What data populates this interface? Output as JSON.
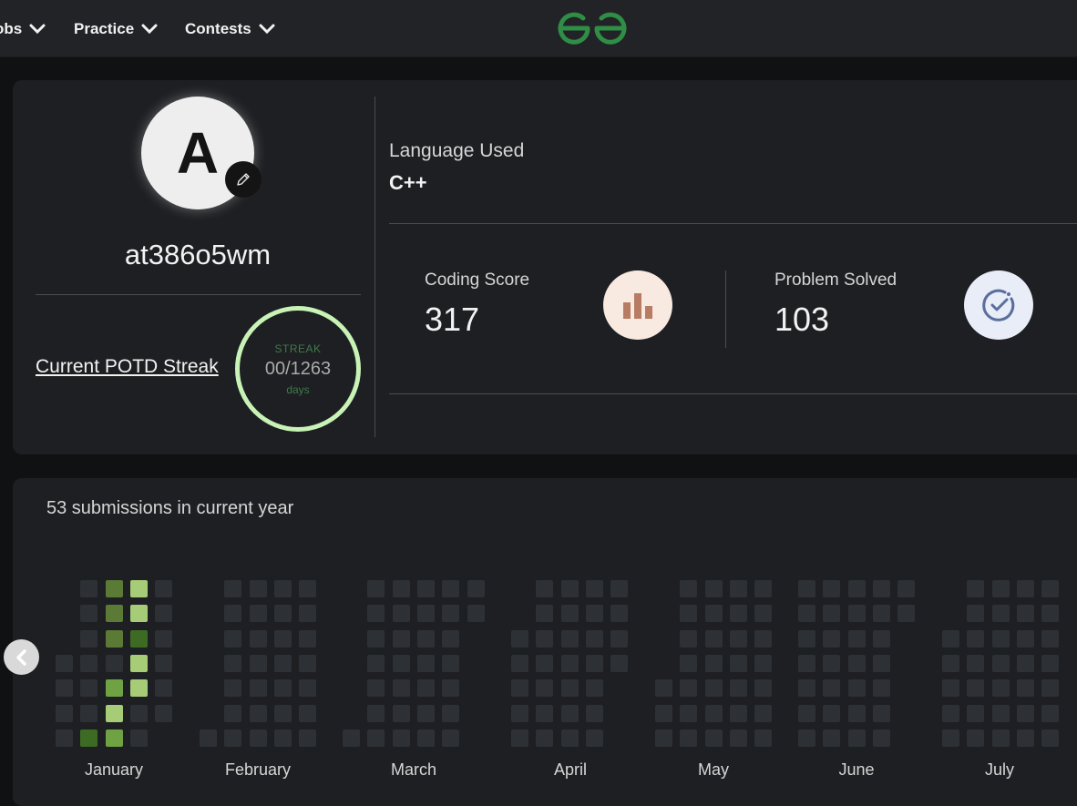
{
  "nav": {
    "items": [
      {
        "label": "obs"
      },
      {
        "label": "Practice"
      },
      {
        "label": "Contests"
      }
    ],
    "logo_icon": "gfg-logo-icon",
    "logo_color": "#2f8d46"
  },
  "profile": {
    "avatar_letter": "A",
    "username": "at386o5wm",
    "edit_icon": "pencil-icon",
    "potd_link": "Current POTD Streak",
    "streak": {
      "label": "STREAK",
      "current": "00",
      "total": "/1263",
      "unit": "days"
    },
    "language_label": "Language Used",
    "language_value": "C++",
    "coding_score_label": "Coding Score",
    "coding_score_value": "317",
    "coding_score_icon": "bar-chart-icon",
    "problems_label": "Problem Solved",
    "problems_value": "103",
    "problems_icon": "check-circle-icon"
  },
  "activity": {
    "summary": "53 submissions in current year",
    "prev_icon": "chevron-left-icon",
    "months": [
      "January",
      "February",
      "March",
      "April",
      "May",
      "June",
      "July"
    ],
    "colors": {
      "empty": "#2d3035",
      "level1": "#3e6b24",
      "level2": "#5a7a36",
      "level3": "#6fa243",
      "level4": "#a6cc78"
    },
    "highlighted_cells": [
      {
        "month": "January",
        "week": 2,
        "day": 0,
        "level": 2
      },
      {
        "month": "January",
        "week": 3,
        "day": 0,
        "level": 4
      },
      {
        "month": "January",
        "week": 2,
        "day": 1,
        "level": 2
      },
      {
        "month": "January",
        "week": 3,
        "day": 1,
        "level": 4
      },
      {
        "month": "January",
        "week": 2,
        "day": 2,
        "level": 2
      },
      {
        "month": "January",
        "week": 3,
        "day": 2,
        "level": 1
      },
      {
        "month": "January",
        "week": 3,
        "day": 3,
        "level": 4
      },
      {
        "month": "January",
        "week": 2,
        "day": 4,
        "level": 3
      },
      {
        "month": "January",
        "week": 3,
        "day": 4,
        "level": 4
      },
      {
        "month": "January",
        "week": 2,
        "day": 5,
        "level": 4
      },
      {
        "month": "January",
        "week": 1,
        "day": 6,
        "level": 1
      },
      {
        "month": "January",
        "week": 2,
        "day": 6,
        "level": 3
      }
    ]
  }
}
